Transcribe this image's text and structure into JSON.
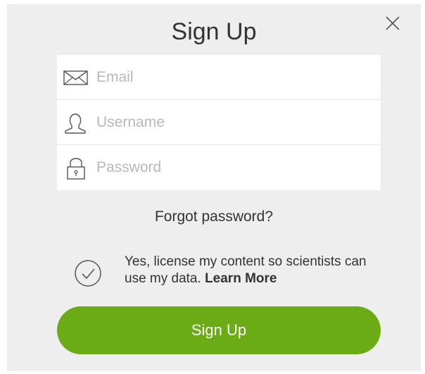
{
  "dialog": {
    "title": "Sign Up",
    "close_icon": "close-icon"
  },
  "form": {
    "email": {
      "placeholder": "Email",
      "value": "",
      "icon": "envelope-icon"
    },
    "username": {
      "placeholder": "Username",
      "value": "",
      "icon": "person-icon"
    },
    "password": {
      "placeholder": "Password",
      "value": "",
      "icon": "lock-icon"
    }
  },
  "forgot_password": "Forgot password?",
  "license": {
    "checked": true,
    "icon": "check-circle-icon",
    "text": "Yes, license my content so scientists can use my data. ",
    "learn_more": "Learn More"
  },
  "submit": {
    "label": "Sign Up",
    "color": "#6bab16"
  },
  "colors": {
    "background": "#eeeeee",
    "field_background": "#ffffff",
    "placeholder": "#b8b8b8",
    "text": "#333333"
  }
}
